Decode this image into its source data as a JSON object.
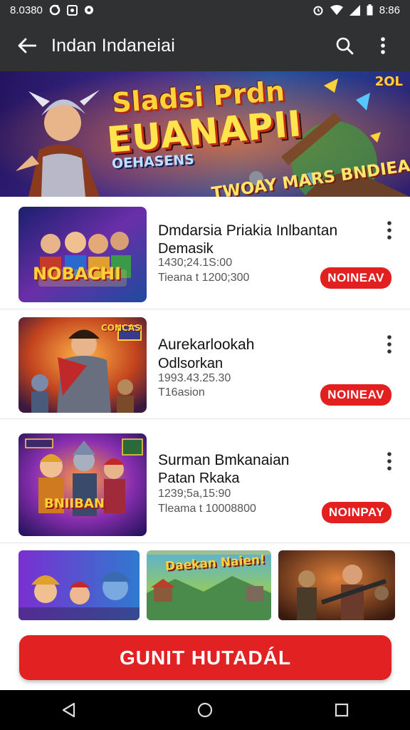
{
  "status_bar": {
    "time": "8.0380",
    "right_text": "8:86"
  },
  "app_bar": {
    "title": "Indan Indaneiai"
  },
  "banner": {
    "line1": "Sladsi Prdn",
    "line2": "EUANAPII",
    "line3": "OEHASENS",
    "line4": "TWOAY MARS BNDIEAN",
    "logo": "2OL"
  },
  "items": [
    {
      "title": "Dmdarsia Priakia Inlbantan",
      "subtitle": "Demasik",
      "meta1": "1430;24.1S:00",
      "meta2": "Tieana t 1200;300",
      "button": "NOINEAV",
      "thumb_label": "NOBACHI"
    },
    {
      "title": "Aurekarlookah",
      "subtitle": "Odlsorkan",
      "meta1": "1993.43.25.30",
      "meta2": "T16asion",
      "button": "NOINEAV",
      "thumb_label": "CONCAS"
    },
    {
      "title": "Surman Bmkanaian",
      "subtitle": "Patan Rkaka",
      "meta1": "1239;5a,15:90",
      "meta2": "Tleama t 10008800",
      "button": "NOINPAY",
      "thumb_label": "BNIIBAN"
    }
  ],
  "grid": [
    {
      "label": ""
    },
    {
      "label": "Daekan Naien!"
    },
    {
      "label": ""
    }
  ],
  "cta": {
    "label": "GUNIT HUTADÁL"
  },
  "colors": {
    "accent": "#e22222",
    "bar": "#2f3133"
  }
}
